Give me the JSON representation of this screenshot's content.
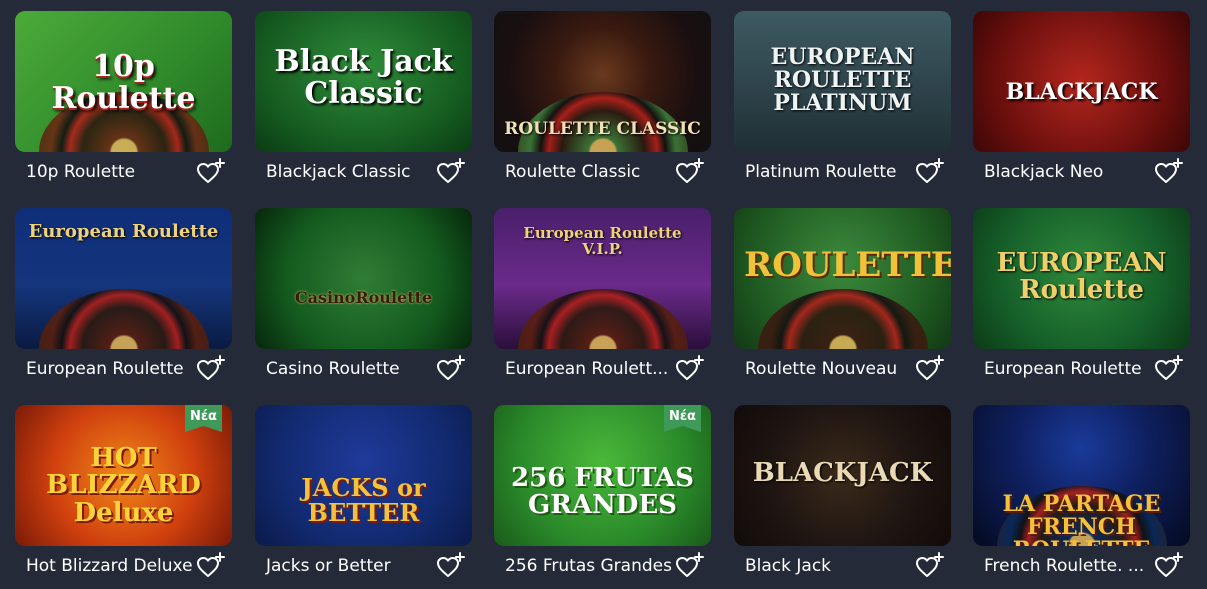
{
  "games": [
    {
      "title": "10p Roulette",
      "art_text": "10p Roulette",
      "badge": "",
      "theme": "green-roulette"
    },
    {
      "title": "Blackjack Classic",
      "art_text": "Black Jack Classic",
      "badge": "",
      "theme": "green-blackjack"
    },
    {
      "title": "Roulette Classic",
      "art_text": "ROULETTE CLASSIC",
      "badge": "",
      "theme": "dark-roulette"
    },
    {
      "title": "Platinum Roulette",
      "art_text": "EUROPEAN ROULETTE PLATINUM",
      "badge": "",
      "theme": "teal-roulette"
    },
    {
      "title": "Blackjack Neo",
      "art_text": "BLACKJACK",
      "badge": "",
      "theme": "red-blackjack"
    },
    {
      "title": "European Roulette",
      "art_text": "European Roulette",
      "badge": "",
      "theme": "blue-roulette"
    },
    {
      "title": "Casino Roulette",
      "art_text": "CasinoRoulette",
      "badge": "",
      "theme": "greengold-roulette"
    },
    {
      "title": "European Roulett...",
      "art_text": "European Roulette V.I.P.",
      "badge": "",
      "theme": "purple-roulette"
    },
    {
      "title": "Roulette Nouveau",
      "art_text": "ROULETTE",
      "badge": "",
      "theme": "green-nouveau"
    },
    {
      "title": "European Roulette",
      "art_text": "EUROPEAN Roulette",
      "badge": "",
      "theme": "green-european"
    },
    {
      "title": "Hot Blizzard Deluxe",
      "art_text": "HOT BLIZZARD Deluxe",
      "badge": "Νέα",
      "theme": "orange-slot"
    },
    {
      "title": "Jacks or Better",
      "art_text": "JACKS or BETTER",
      "badge": "",
      "theme": "blue-poker"
    },
    {
      "title": "256 Frutas Grandes",
      "art_text": "256 FRUTAS GRANDES",
      "badge": "Νέα",
      "theme": "green-slot"
    },
    {
      "title": "Black Jack",
      "art_text": "BLACKJACK",
      "badge": "",
      "theme": "dark-blackjack"
    },
    {
      "title": "French Roulette. ...",
      "art_text": "LA PARTAGE FRENCH ROULETTE",
      "badge": "",
      "theme": "neon-roulette"
    }
  ],
  "icons": {
    "favorite": "heart-plus-icon"
  },
  "colors": {
    "background": "#252a38",
    "badge": "#3f9a5a",
    "text": "#ffffff"
  }
}
